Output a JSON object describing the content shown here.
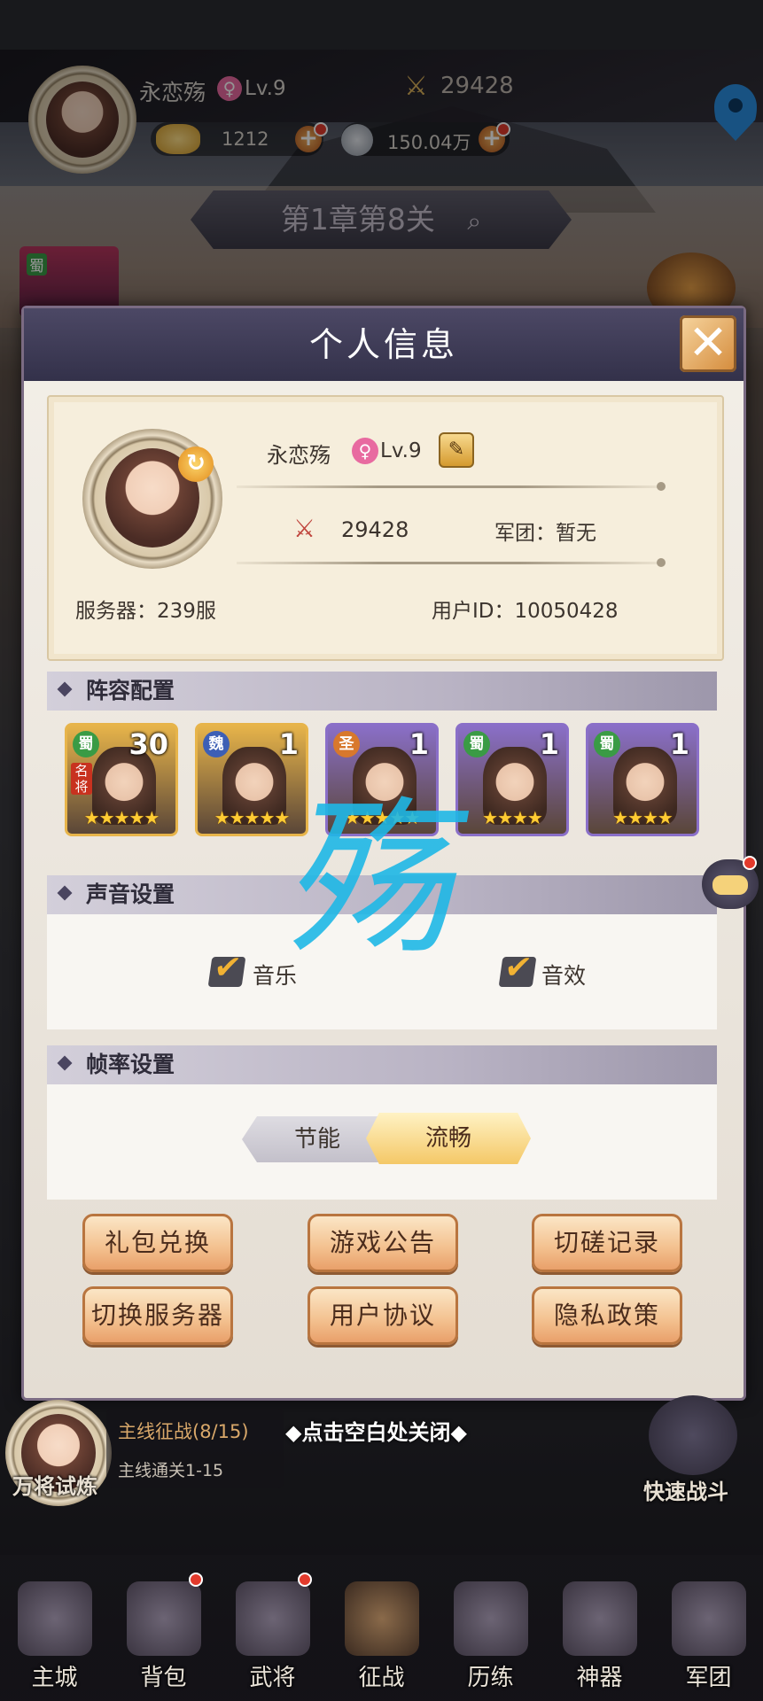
{
  "top_bar": {
    "player_name": "永恋殇",
    "level": "Lv.9",
    "power": "29428",
    "gold": "1212",
    "silver": "150.04万"
  },
  "chapter": {
    "label": "第1章第8关"
  },
  "modal": {
    "title": "个人信息",
    "profile": {
      "name": "永恋殇",
      "level": "Lv.9",
      "power": "29428",
      "legion": "军团：暂无",
      "server": "服务器：239服",
      "user_id": "用户ID：10050428"
    },
    "lineup": {
      "title": "阵容配置",
      "heroes": [
        {
          "faction": "蜀",
          "level": "30",
          "tag": "名将",
          "stars": "★★★★★",
          "color": "#e7b44a",
          "faction_color": "#3a9b45"
        },
        {
          "faction": "魏",
          "level": "1",
          "tag": "",
          "stars": "★★★★★",
          "color": "#e7b44a",
          "faction_color": "#3d5fb5"
        },
        {
          "faction": "圣",
          "level": "1",
          "tag": "",
          "stars": "★★★★★",
          "color": "#8a6fc8",
          "faction_color": "#d8782c"
        },
        {
          "faction": "蜀",
          "level": "1",
          "tag": "",
          "stars": "★★★★",
          "color": "#8a6fc8",
          "faction_color": "#3a9b45"
        },
        {
          "faction": "蜀",
          "level": "1",
          "tag": "",
          "stars": "★★★★",
          "color": "#8a6fc8",
          "faction_color": "#3a9b45"
        }
      ]
    },
    "sound": {
      "title": "声音设置",
      "music_label": "音乐",
      "sfx_label": "音效"
    },
    "framerate": {
      "title": "帧率设置",
      "option_left": "节能",
      "option_right": "流畅"
    },
    "buttons": {
      "gift": "礼包兑换",
      "notice": "游戏公告",
      "duel": "切磋记录",
      "switch_server": "切换服务器",
      "agreement": "用户协议",
      "privacy": "隐私政策"
    },
    "handwriting": "殇"
  },
  "below_modal": {
    "trial": "万将试炼",
    "quest_title": "主线征战(8/15)",
    "quest_sub": "主线通关1-15",
    "tap_close": "点击空白处关闭",
    "quick_battle": "快速战斗"
  },
  "bottom_nav": [
    {
      "label": "主城"
    },
    {
      "label": "背包"
    },
    {
      "label": "武将"
    },
    {
      "label": "征战"
    },
    {
      "label": "历练"
    },
    {
      "label": "神器"
    },
    {
      "label": "军团"
    }
  ],
  "colors": {
    "modal_header": "#3f3b57",
    "accent_gold": "#f1b233",
    "handwriting": "#1fb8e6"
  }
}
